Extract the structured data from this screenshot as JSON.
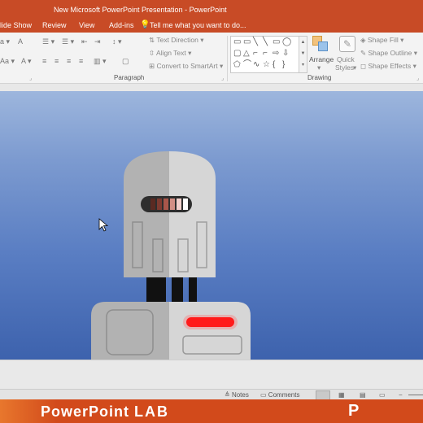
{
  "window": {
    "title": "New Microsoft PowerPoint Presentation - PowerPoint"
  },
  "tabs": [
    {
      "label": "lide Show"
    },
    {
      "label": "Review"
    },
    {
      "label": "View"
    },
    {
      "label": "Add-ins"
    }
  ],
  "tell_me": {
    "text": "Tell me what you want to do..."
  },
  "ribbon": {
    "paragraph": {
      "label": "Paragraph",
      "text_direction": "Text Direction",
      "align_text": "Align Text",
      "convert_smartart": "Convert to SmartArt"
    },
    "drawing": {
      "label": "Drawing",
      "arrange": "Arrange",
      "quick_styles_1": "Quick",
      "quick_styles_2": "Styles",
      "shape_fill": "Shape Fill",
      "shape_outline": "Shape Outline",
      "shape_effects": "Shape Effects"
    }
  },
  "status": {
    "notes": "Notes",
    "comments": "Comments"
  },
  "footer": {
    "brand_main": "PowerPoint",
    "brand_lab": "LAB",
    "logo_letter": "P"
  },
  "colors": {
    "accent": "#c84b26",
    "footer": "#d24a1b",
    "robot_red": "#ff1a1a"
  }
}
